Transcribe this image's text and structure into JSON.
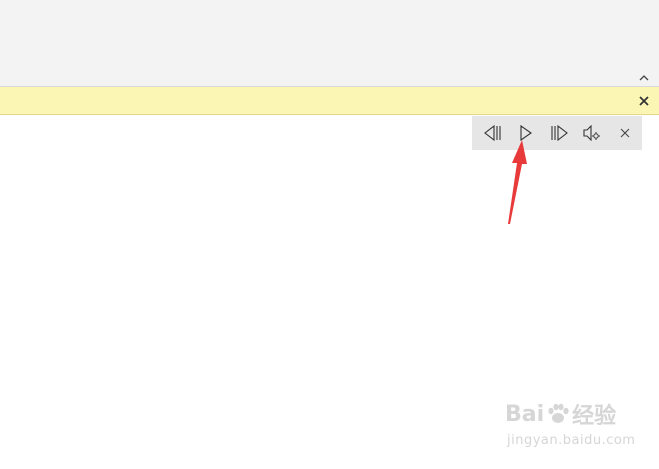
{
  "ribbon": {
    "collapse_icon": "chevron-up-icon"
  },
  "notice_bar": {
    "text": "",
    "close_icon": "close-icon",
    "background": "#fcf6b5"
  },
  "read_aloud_toolbar": {
    "buttons": [
      {
        "name": "previous-paragraph-button",
        "icon": "skip-back-icon"
      },
      {
        "name": "play-button",
        "icon": "play-icon"
      },
      {
        "name": "next-paragraph-button",
        "icon": "skip-forward-icon"
      },
      {
        "name": "voice-settings-button",
        "icon": "speaker-settings-icon"
      },
      {
        "name": "close-read-aloud-button",
        "icon": "close-icon"
      }
    ]
  },
  "annotation": {
    "arrow_color": "#e83a3a",
    "points_to": "play-button"
  },
  "watermark": {
    "brand_left": "Bai",
    "brand_right": "经验",
    "url": "jingyan.baidu.com"
  }
}
